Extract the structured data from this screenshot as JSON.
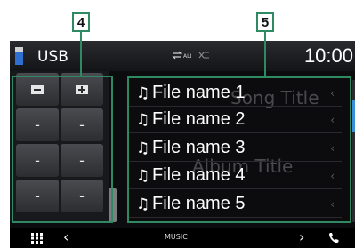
{
  "callouts": {
    "left": "4",
    "right": "5"
  },
  "topbar": {
    "source": "USB",
    "time": "10:00",
    "repeat_icon": "repeat-all-icon",
    "shuffle_icon": "shuffle-icon"
  },
  "background": {
    "song_title": "Song Title",
    "album_title": "Album Title"
  },
  "left_panel": {
    "folder_up_icon": "folder-up-icon",
    "folder_add_icon": "folder-add-icon",
    "slots": [
      "-",
      "-",
      "-",
      "-",
      "-",
      "-"
    ]
  },
  "file_list": {
    "note_icon": "♫",
    "items": [
      "File name 1",
      "File name 2",
      "File name 3",
      "File name 4",
      "File name 5"
    ]
  },
  "bottom_bar": {
    "label": "MUSIC",
    "menu_icon": "grid-icon",
    "back_icon": "chevron-left-icon",
    "forward_icon": "chevron-right-icon",
    "phone_icon": "phone-icon"
  },
  "colors": {
    "callout": "#2f8a64",
    "scroll_thumb": "#3a8fd8",
    "screen_bg": "#0c0c0e"
  }
}
